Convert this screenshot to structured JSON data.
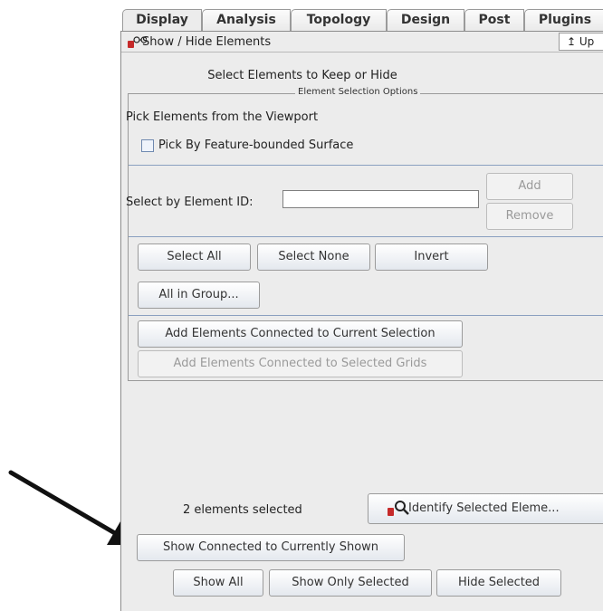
{
  "tabs": [
    {
      "label": "Display",
      "active": true
    },
    {
      "label": "Analysis"
    },
    {
      "label": "Topology"
    },
    {
      "label": "Design"
    },
    {
      "label": "Post"
    },
    {
      "label": "Plugins"
    }
  ],
  "panel": {
    "title": "Show / Hide Elements",
    "up_label": "Up",
    "heading": "Select Elements to Keep or Hide"
  },
  "selection_options": {
    "legend": "Element Selection Options",
    "pick_label": "Pick Elements from the Viewport",
    "checkbox_label": "Pick By Feature-bounded Surface",
    "checkbox_checked": false,
    "select_id_label": "Select by Element  ID:",
    "id_value": "",
    "add_label": "Add",
    "remove_label": "Remove",
    "select_all": "Select All",
    "select_none": "Select None",
    "invert": "Invert",
    "all_in_group": "All in Group...",
    "add_connected_current": "Add Elements Connected to Current Selection",
    "add_connected_grids": "Add Elements Connected to Selected Grids"
  },
  "footer": {
    "count_text": "2 elements selected",
    "identify_label": "Identify Selected Eleme...",
    "show_connected": "Show Connected to Currently Shown",
    "show_all": "Show All",
    "show_only_selected": "Show Only Selected",
    "hide_selected": "Hide Selected"
  },
  "icons": {
    "title_icon": "eyeglasses-icon",
    "identify_icon": "magnifier-icon",
    "arrow": "pointer-arrow"
  },
  "colors": {
    "panel_bg": "#ececec",
    "separator": "#8aa0c0",
    "accent_red": "#c62a2a"
  }
}
